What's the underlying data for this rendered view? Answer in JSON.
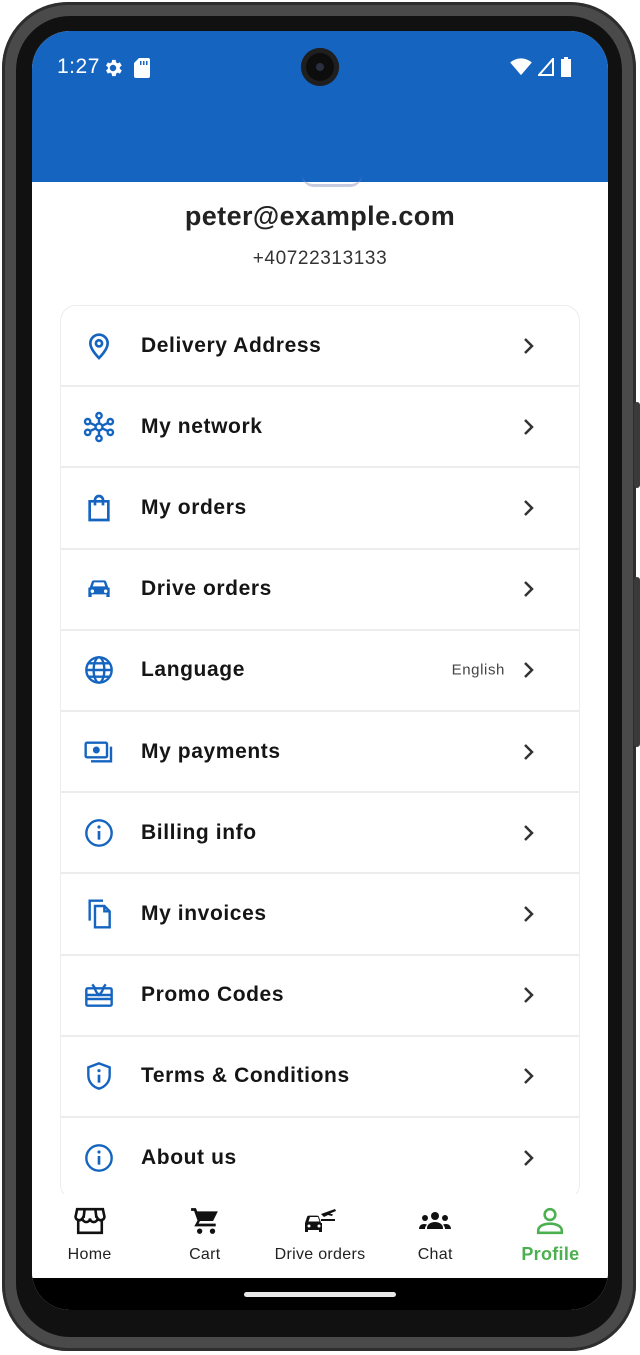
{
  "status_bar": {
    "time": "1:27",
    "left_icons": [
      "settings-gear-icon",
      "sd-card-icon"
    ],
    "right_icons": [
      "wifi-icon",
      "signal-icon",
      "battery-icon"
    ]
  },
  "profile": {
    "email": "peter@example.com",
    "phone": "+40722313133"
  },
  "menu": {
    "items": [
      {
        "key": "delivery-address",
        "label": "Delivery Address",
        "value": "",
        "icon": "location-pin-icon"
      },
      {
        "key": "my-network",
        "label": "My network",
        "value": "",
        "icon": "network-icon"
      },
      {
        "key": "my-orders",
        "label": "My orders",
        "value": "",
        "icon": "shopping-bag-icon"
      },
      {
        "key": "drive-orders",
        "label": "Drive orders",
        "value": "",
        "icon": "car-icon"
      },
      {
        "key": "language",
        "label": "Language",
        "value": "English",
        "icon": "globe-icon"
      },
      {
        "key": "my-payments",
        "label": "My payments",
        "value": "",
        "icon": "payments-icon"
      },
      {
        "key": "billing-info",
        "label": "Billing info",
        "value": "",
        "icon": "info-icon"
      },
      {
        "key": "my-invoices",
        "label": "My invoices",
        "value": "",
        "icon": "documents-icon"
      },
      {
        "key": "promo-codes",
        "label": "Promo Codes",
        "value": "",
        "icon": "gift-card-icon"
      },
      {
        "key": "terms-conditions",
        "label": "Terms & Conditions",
        "value": "",
        "icon": "shield-info-icon"
      },
      {
        "key": "about-us",
        "label": "About us",
        "value": "",
        "icon": "info-icon"
      }
    ]
  },
  "bottom_nav": {
    "items": [
      {
        "label": "Home",
        "icon": "store-icon",
        "active": false
      },
      {
        "label": "Cart",
        "icon": "cart-icon",
        "active": false
      },
      {
        "label": "Drive orders",
        "icon": "car-delivery-icon",
        "active": false
      },
      {
        "label": "Chat",
        "icon": "group-icon",
        "active": false
      },
      {
        "label": "Profile",
        "icon": "person-icon",
        "active": true
      }
    ]
  },
  "colors": {
    "primary_blue": "#1565c0",
    "active_green": "#4caf50",
    "text_dark": "#151515",
    "divider": "#ececec"
  }
}
